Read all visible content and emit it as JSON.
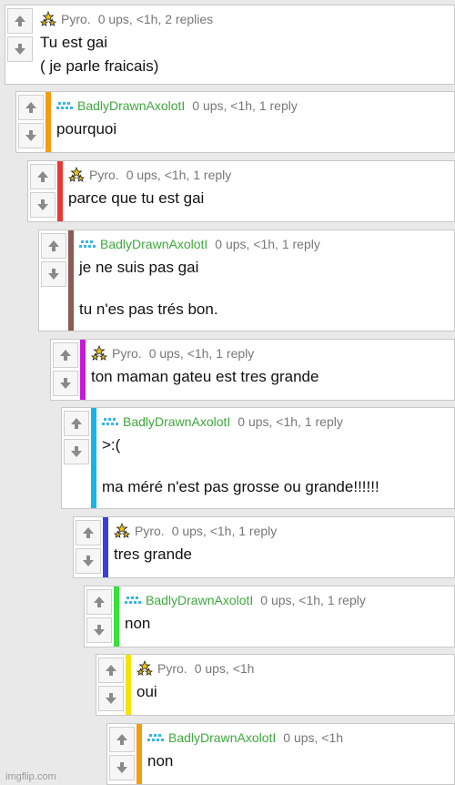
{
  "watermark": "imgflip.com",
  "comments": [
    {
      "user": "Pyro.",
      "meta": "0 ups, <1h, 2 replies",
      "lines": [
        "Tu est gai",
        "( je parle fraicais)"
      ],
      "bar": "",
      "avatar": "stars-icon"
    },
    {
      "user": "BadlyDrawnAxolotI",
      "meta": "0 ups, <1h, 1 reply",
      "lines": [
        "pourquoi"
      ],
      "bar": "#f39c12",
      "avatar": "pixel-axolotl-icon"
    },
    {
      "user": "Pyro.",
      "meta": "0 ups, <1h, 1 reply",
      "lines": [
        "parce que tu est gai"
      ],
      "bar": "#e53935",
      "avatar": "stars-icon"
    },
    {
      "user": "BadlyDrawnAxolotI",
      "meta": "0 ups, <1h, 1 reply",
      "lines": [
        "je ne suis pas gai",
        "tu n'es pas trés bon."
      ],
      "bar": "#8d5a55",
      "avatar": "pixel-axolotl-icon"
    },
    {
      "user": "Pyro.",
      "meta": "0 ups, <1h, 1 reply",
      "lines": [
        "ton maman gateu est tres grande"
      ],
      "bar": "#c51bd6",
      "avatar": "stars-icon"
    },
    {
      "user": "BadlyDrawnAxolotI",
      "meta": "0 ups, <1h, 1 reply",
      "lines": [
        ">:(",
        "ma méré n'est pas grosse ou grande!!!!!!"
      ],
      "bar": "#18b4e8",
      "avatar": "pixel-axolotl-icon"
    },
    {
      "user": "Pyro.",
      "meta": "0 ups, <1h, 1 reply",
      "lines": [
        "tres grande"
      ],
      "bar": "#3a3fe0",
      "avatar": "stars-icon"
    },
    {
      "user": "BadlyDrawnAxolotI",
      "meta": "0 ups, <1h, 1 reply",
      "lines": [
        "non"
      ],
      "bar": "#36e13a",
      "avatar": "pixel-axolotl-icon"
    },
    {
      "user": "Pyro.",
      "meta": "0 ups, <1h",
      "lines": [
        "oui"
      ],
      "bar": "#f2e600",
      "avatar": "stars-icon"
    },
    {
      "user": "BadlyDrawnAxolotI",
      "meta": "0 ups, <1h",
      "lines": [
        "non"
      ],
      "bar": "#f39c12",
      "avatar": "pixel-axolotl-icon"
    }
  ]
}
